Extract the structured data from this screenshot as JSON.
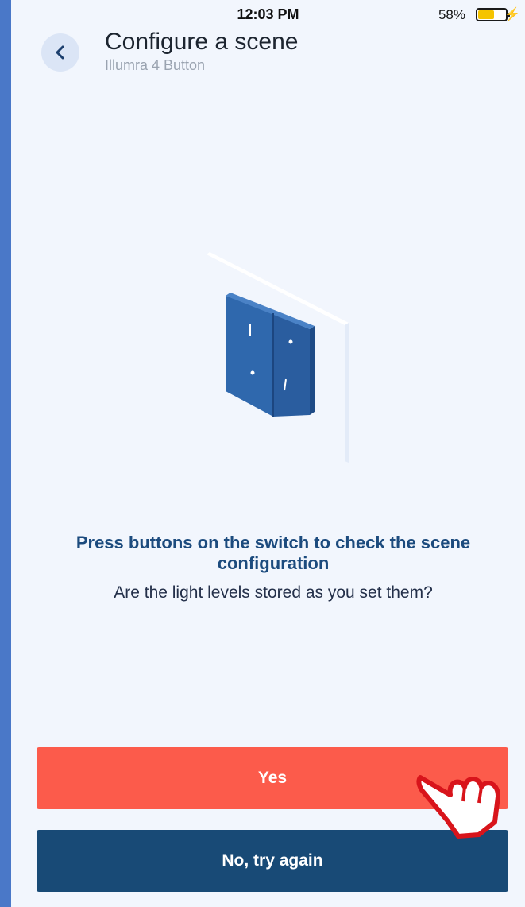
{
  "status_bar": {
    "time": "12:03 PM",
    "battery_percent": "58%",
    "battery_level": 0.58,
    "icons": [
      "battery-icon",
      "charging-bolt-icon"
    ]
  },
  "header": {
    "back_icon": "chevron-left-icon",
    "title": "Configure a scene",
    "subtitle": "Illumra 4 Button"
  },
  "content": {
    "illustration": "wall-switch-illustration",
    "heading": "Press buttons on the switch to check the scene configuration",
    "body": "Are the light levels stored as you set them?"
  },
  "actions": {
    "yes_label": "Yes",
    "no_label": "No, try again"
  },
  "colors": {
    "background": "#f2f6fd",
    "yes_button": "#fc5b4b",
    "no_button": "#184a76",
    "heading": "#1c4b7e"
  }
}
